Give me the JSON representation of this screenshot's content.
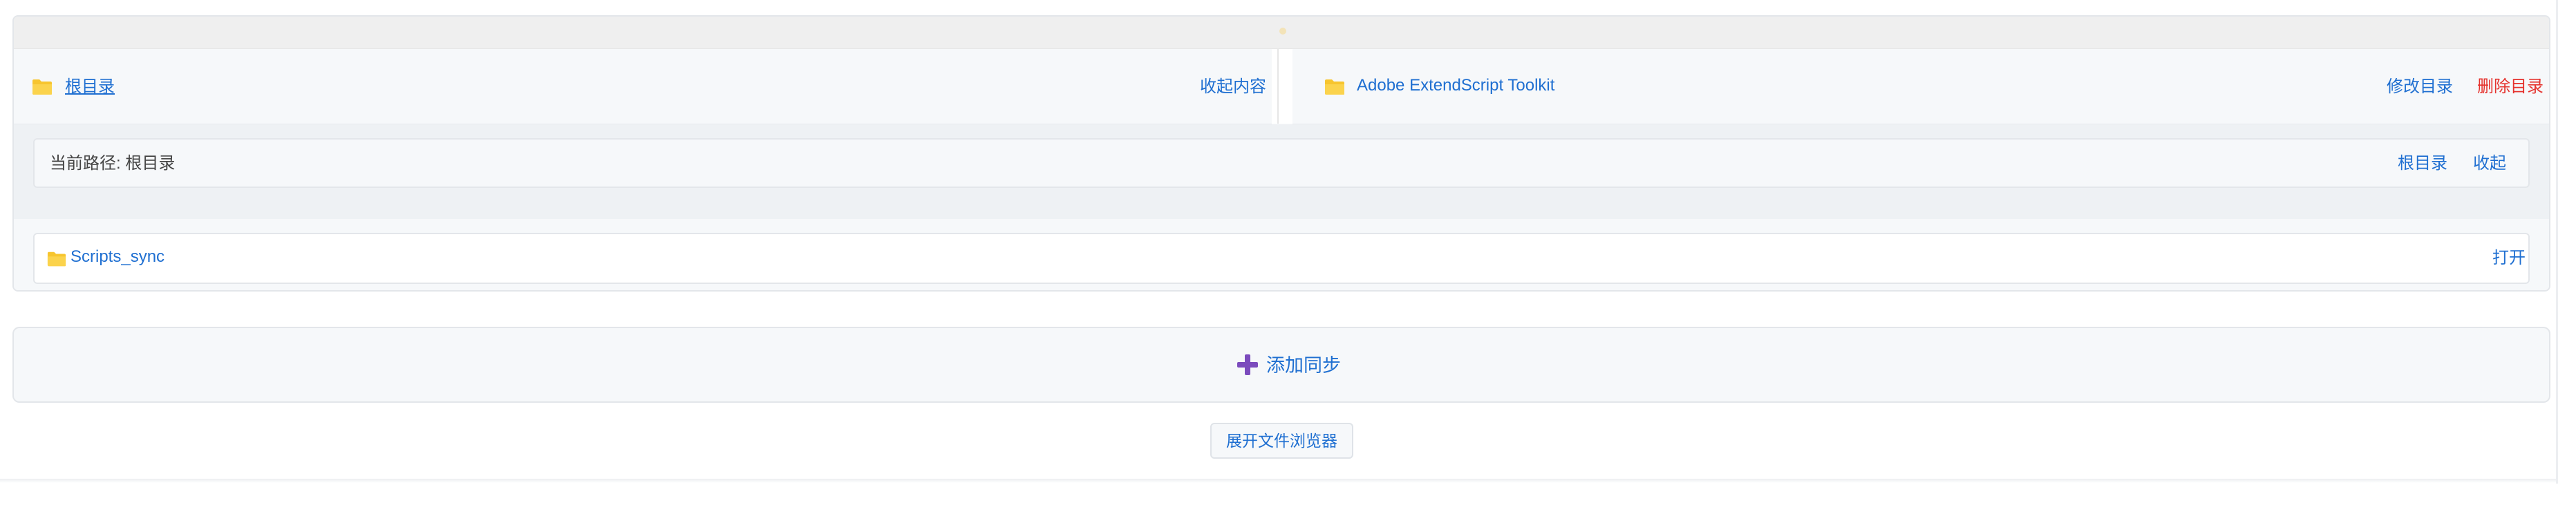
{
  "sync_entry": {
    "source": {
      "folder_icon": "folder-icon",
      "name": "根目录",
      "collapse_label": "收起内容"
    },
    "target": {
      "folder_icon": "folder-icon",
      "name": "Adobe ExtendScript Toolkit",
      "edit_label": "修改目录",
      "delete_label": "删除目录"
    },
    "path_bar": {
      "current_path": "当前路径: 根目录",
      "root_label": "根目录",
      "collapse_label": "收起"
    },
    "folder_list": [
      {
        "name": "Scripts_sync",
        "open_label": "打开",
        "icon": "folder-icon"
      }
    ]
  },
  "add_sync": {
    "icon": "plus-icon",
    "label": "添加同步"
  },
  "file_browser_button": {
    "label": "展开文件浏览器"
  },
  "colors": {
    "link": "#1f6fd1",
    "danger": "#e5322d",
    "folder": "#f7c52e",
    "plus": "#7b4bbd"
  }
}
